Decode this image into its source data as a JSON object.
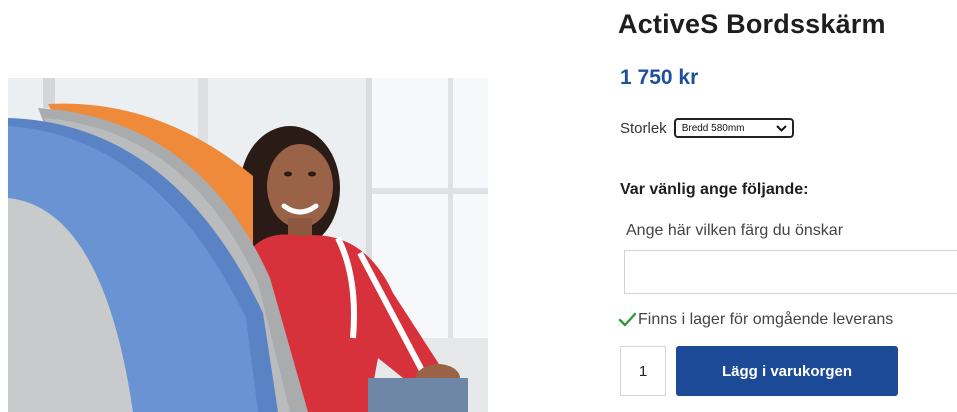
{
  "product": {
    "title": "ActiveS Bordsskärm",
    "price": "1 750 kr",
    "image_alt": "photo-desk-screen-with-person"
  },
  "size": {
    "label": "Storlek",
    "selected": "Bredd 580mm"
  },
  "options": {
    "heading": "Var vänlig ange följande:",
    "color_label": "Ange här vilken färg du önskar",
    "color_value": ""
  },
  "stock": {
    "text": "Finns i lager för omgående leverans",
    "check_color": "#2e9a3c"
  },
  "cart": {
    "quantity": "1",
    "add_label": "Lägg i varukorgen",
    "button_color": "#1c4a96"
  },
  "colors": {
    "price": "#1f4f9c"
  }
}
